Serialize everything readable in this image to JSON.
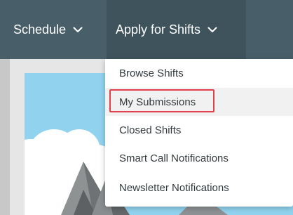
{
  "nav": {
    "items": [
      {
        "label": "Schedule",
        "icon": "chevron-down-icon"
      },
      {
        "label": "Apply for Shifts",
        "icon": "chevron-down-icon"
      }
    ]
  },
  "dropdown": {
    "items": [
      {
        "label": "Browse Shifts"
      },
      {
        "label": "My Submissions",
        "state": "highlighted"
      },
      {
        "label": "Closed Shifts"
      },
      {
        "label": "Smart Call Notifications"
      },
      {
        "label": "Newsletter Notifications"
      }
    ]
  },
  "colors": {
    "navbar": "#485f6a",
    "nav_active": "#3f535d",
    "highlight_border": "#e2414b",
    "hero_sky": "#91d3ef"
  }
}
